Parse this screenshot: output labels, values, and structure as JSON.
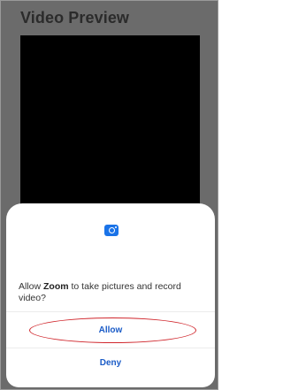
{
  "preview": {
    "title": "Video Preview"
  },
  "dialog": {
    "icon": "camera-icon",
    "prompt_prefix": "Allow ",
    "app_name": "Zoom",
    "prompt_suffix": " to take pictures and record video?",
    "allow_label": "Allow",
    "deny_label": "Deny",
    "accent_color": "#1a5bc7",
    "highlight_color": "#d0262c"
  }
}
